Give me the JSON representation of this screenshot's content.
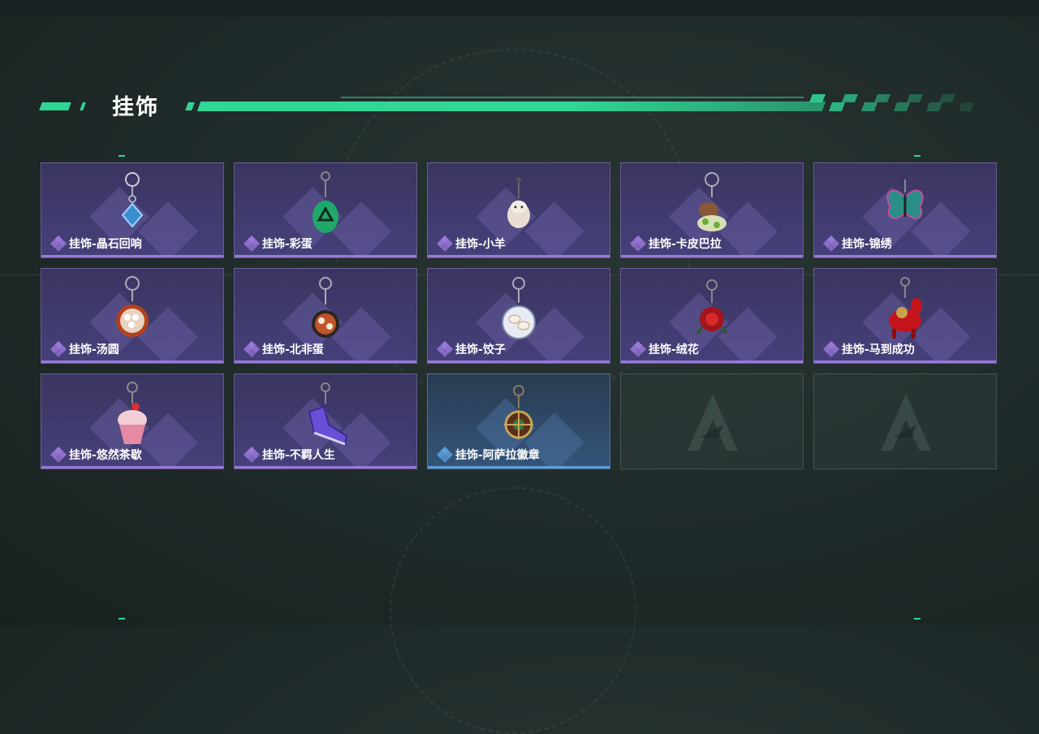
{
  "section": {
    "title": "挂饰"
  },
  "items": [
    {
      "label": "挂饰-晶石回响",
      "rarity": "purple",
      "icon": "crystal-charm-icon"
    },
    {
      "label": "挂饰-彩蛋",
      "rarity": "purple",
      "icon": "green-egg-charm-icon"
    },
    {
      "label": "挂饰-小羊",
      "rarity": "purple",
      "icon": "lamb-charm-icon"
    },
    {
      "label": "挂饰-卡皮巴拉",
      "rarity": "purple",
      "icon": "capybara-charm-icon"
    },
    {
      "label": "挂饰-锦绣",
      "rarity": "purple",
      "icon": "butterfly-charm-icon"
    },
    {
      "label": "挂饰-汤圆",
      "rarity": "purple",
      "icon": "tangyuan-bowl-charm-icon"
    },
    {
      "label": "挂饰-北非蛋",
      "rarity": "purple",
      "icon": "shakshuka-pan-charm-icon"
    },
    {
      "label": "挂饰-饺子",
      "rarity": "purple",
      "icon": "dumpling-plate-charm-icon"
    },
    {
      "label": "挂饰-绒花",
      "rarity": "purple",
      "icon": "red-flower-charm-icon"
    },
    {
      "label": "挂饰-马到成功",
      "rarity": "purple",
      "icon": "red-horse-charm-icon"
    },
    {
      "label": "挂饰-悠然茶歇",
      "rarity": "purple",
      "icon": "cupcake-charm-icon"
    },
    {
      "label": "挂饰-不羁人生",
      "rarity": "purple",
      "icon": "sneaker-charm-icon"
    },
    {
      "label": "挂饰-阿萨拉徽章",
      "rarity": "blue",
      "icon": "asala-badge-charm-icon"
    }
  ],
  "empty_slots": 2,
  "colors": {
    "accent": "#2fd696",
    "purple_rarity": "#9a78d8",
    "blue_rarity": "#5a9fdc"
  }
}
